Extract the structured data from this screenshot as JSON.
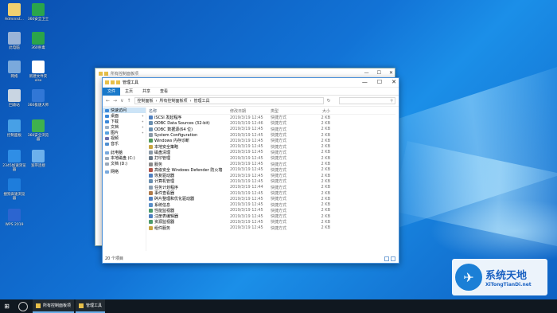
{
  "desktop": {
    "icons": [
      {
        "label": "Administ...",
        "color": "#f0d070"
      },
      {
        "label": "360安全卫士",
        "color": "#2aa54c"
      },
      {
        "label": "此电脑",
        "color": "#9ab4d8"
      },
      {
        "label": "360杀毒",
        "color": "#2ba44a"
      },
      {
        "label": "网络",
        "color": "#7aa9dc"
      },
      {
        "label": "新建文件夹 xlsx",
        "color": "#ffffff"
      },
      {
        "label": "回收站",
        "color": "#c9d5e2"
      },
      {
        "label": "360极速大师",
        "color": "#3177d6"
      },
      {
        "label": "控制面板",
        "color": "#47a0e6"
      },
      {
        "label": "360安全浏览器",
        "color": "#3fb14e"
      },
      {
        "label": "2345加速浏览器",
        "color": "#2f8ee6"
      },
      {
        "label": "宽带连接",
        "color": "#6cb0ec"
      },
      {
        "label": "搜狗高速浏览器",
        "color": "#1e7ddc"
      },
      {
        "label": "WPS 2019",
        "color": "#2c65d0"
      }
    ]
  },
  "back_window": {
    "title": "所有控制面板项"
  },
  "window": {
    "title": "管理工具",
    "ribbon_tabs": [
      "文件",
      "主页",
      "共享",
      "查看"
    ],
    "path": [
      "控制面板",
      "所有控制面板项",
      "管理工具"
    ],
    "search_icon": "search-icon",
    "nav": [
      "←",
      "→",
      "∨",
      "↑"
    ],
    "sidebar": [
      {
        "label": "快速访问",
        "color": "#3a88d8",
        "pinned": false,
        "selected": true
      },
      {
        "label": "桌面",
        "color": "#3a88d8",
        "pinned": true
      },
      {
        "label": "下载",
        "color": "#3a88d8",
        "pinned": true
      },
      {
        "label": "文档",
        "color": "#9ab0c8",
        "pinned": true
      },
      {
        "label": "图片",
        "color": "#58a3e0",
        "pinned": true
      },
      {
        "label": "视频",
        "color": "#6b6fae",
        "pinned": false
      },
      {
        "label": "音乐",
        "color": "#4f8fd0",
        "pinned": false
      },
      {
        "label": "此电脑",
        "color": "#7aa9dc",
        "pinned": false
      },
      {
        "label": "本地磁盘 (C:)",
        "color": "#9aa9ba",
        "pinned": false
      },
      {
        "label": "文档 (D:)",
        "color": "#9aa9ba",
        "pinned": false
      },
      {
        "label": "网络",
        "color": "#7aa9dc",
        "pinned": false
      }
    ],
    "headers": [
      "名称",
      "修改日期",
      "类型",
      "大小"
    ],
    "files": [
      {
        "name": "iSCSI 发起程序",
        "date": "2019/3/19 12:45",
        "type": "快捷方式",
        "size": "2 KB",
        "color": "#4f7fbf"
      },
      {
        "name": "ODBC Data Sources (32-bit)",
        "date": "2019/3/19 12:46",
        "type": "快捷方式",
        "size": "2 KB",
        "color": "#6a8fb0"
      },
      {
        "name": "ODBC 数据源(64 位)",
        "date": "2019/3/19 12:45",
        "type": "快捷方式",
        "size": "2 KB",
        "color": "#6a8fb0"
      },
      {
        "name": "System Configuration",
        "date": "2019/3/19 12:45",
        "type": "快捷方式",
        "size": "2 KB",
        "color": "#8b9aa8"
      },
      {
        "name": "Windows 内存诊断",
        "date": "2019/3/19 12:45",
        "type": "快捷方式",
        "size": "2 KB",
        "color": "#4f9a5a"
      },
      {
        "name": "本地安全策略",
        "date": "2019/3/19 12:45",
        "type": "快捷方式",
        "size": "2 KB",
        "color": "#c9a542"
      },
      {
        "name": "磁盘清理",
        "date": "2019/3/19 12:45",
        "type": "快捷方式",
        "size": "2 KB",
        "color": "#8b9aa8"
      },
      {
        "name": "打印管理",
        "date": "2019/3/19 12:45",
        "type": "快捷方式",
        "size": "2 KB",
        "color": "#6a7a8a"
      },
      {
        "name": "服务",
        "date": "2019/3/19 12:45",
        "type": "快捷方式",
        "size": "2 KB",
        "color": "#8a8a8a"
      },
      {
        "name": "高级安全 Windows Defender 防火墙",
        "date": "2019/3/19 12:45",
        "type": "快捷方式",
        "size": "2 KB",
        "color": "#b0544a"
      },
      {
        "name": "恢复驱动器",
        "date": "2019/3/19 12:45",
        "type": "快捷方式",
        "size": "2 KB",
        "color": "#4f7fbf"
      },
      {
        "name": "计算机管理",
        "date": "2019/3/19 12:45",
        "type": "快捷方式",
        "size": "2 KB",
        "color": "#6a8fb0"
      },
      {
        "name": "任务计划程序",
        "date": "2019/3/19 12:44",
        "type": "快捷方式",
        "size": "2 KB",
        "color": "#8a9db0"
      },
      {
        "name": "事件查看器",
        "date": "2019/3/19 12:45",
        "type": "快捷方式",
        "size": "2 KB",
        "color": "#b07a4a"
      },
      {
        "name": "碎片整理和优化驱动器",
        "date": "2019/3/19 12:45",
        "type": "快捷方式",
        "size": "2 KB",
        "color": "#4f7fbf"
      },
      {
        "name": "系统信息",
        "date": "2019/3/19 12:45",
        "type": "快捷方式",
        "size": "2 KB",
        "color": "#5a8fc8"
      },
      {
        "name": "性能监视器",
        "date": "2019/3/19 12:45",
        "type": "快捷方式",
        "size": "2 KB",
        "color": "#4a9a6a"
      },
      {
        "name": "注册表编辑器",
        "date": "2019/3/19 12:45",
        "type": "快捷方式",
        "size": "2 KB",
        "color": "#4f7fbf"
      },
      {
        "name": "资源监视器",
        "date": "2019/3/19 12:45",
        "type": "快捷方式",
        "size": "2 KB",
        "color": "#4a9a6a"
      },
      {
        "name": "组件服务",
        "date": "2019/3/19 12:45",
        "type": "快捷方式",
        "size": "2 KB",
        "color": "#c9a542"
      }
    ],
    "status": "20 个项目"
  },
  "taskbar": {
    "start_icon": "windows-logo-icon",
    "tasks": [
      "所有控制面板项",
      "管理工具"
    ]
  },
  "watermark": {
    "title": "系统天地",
    "url": "XiTongTianDi.net"
  }
}
